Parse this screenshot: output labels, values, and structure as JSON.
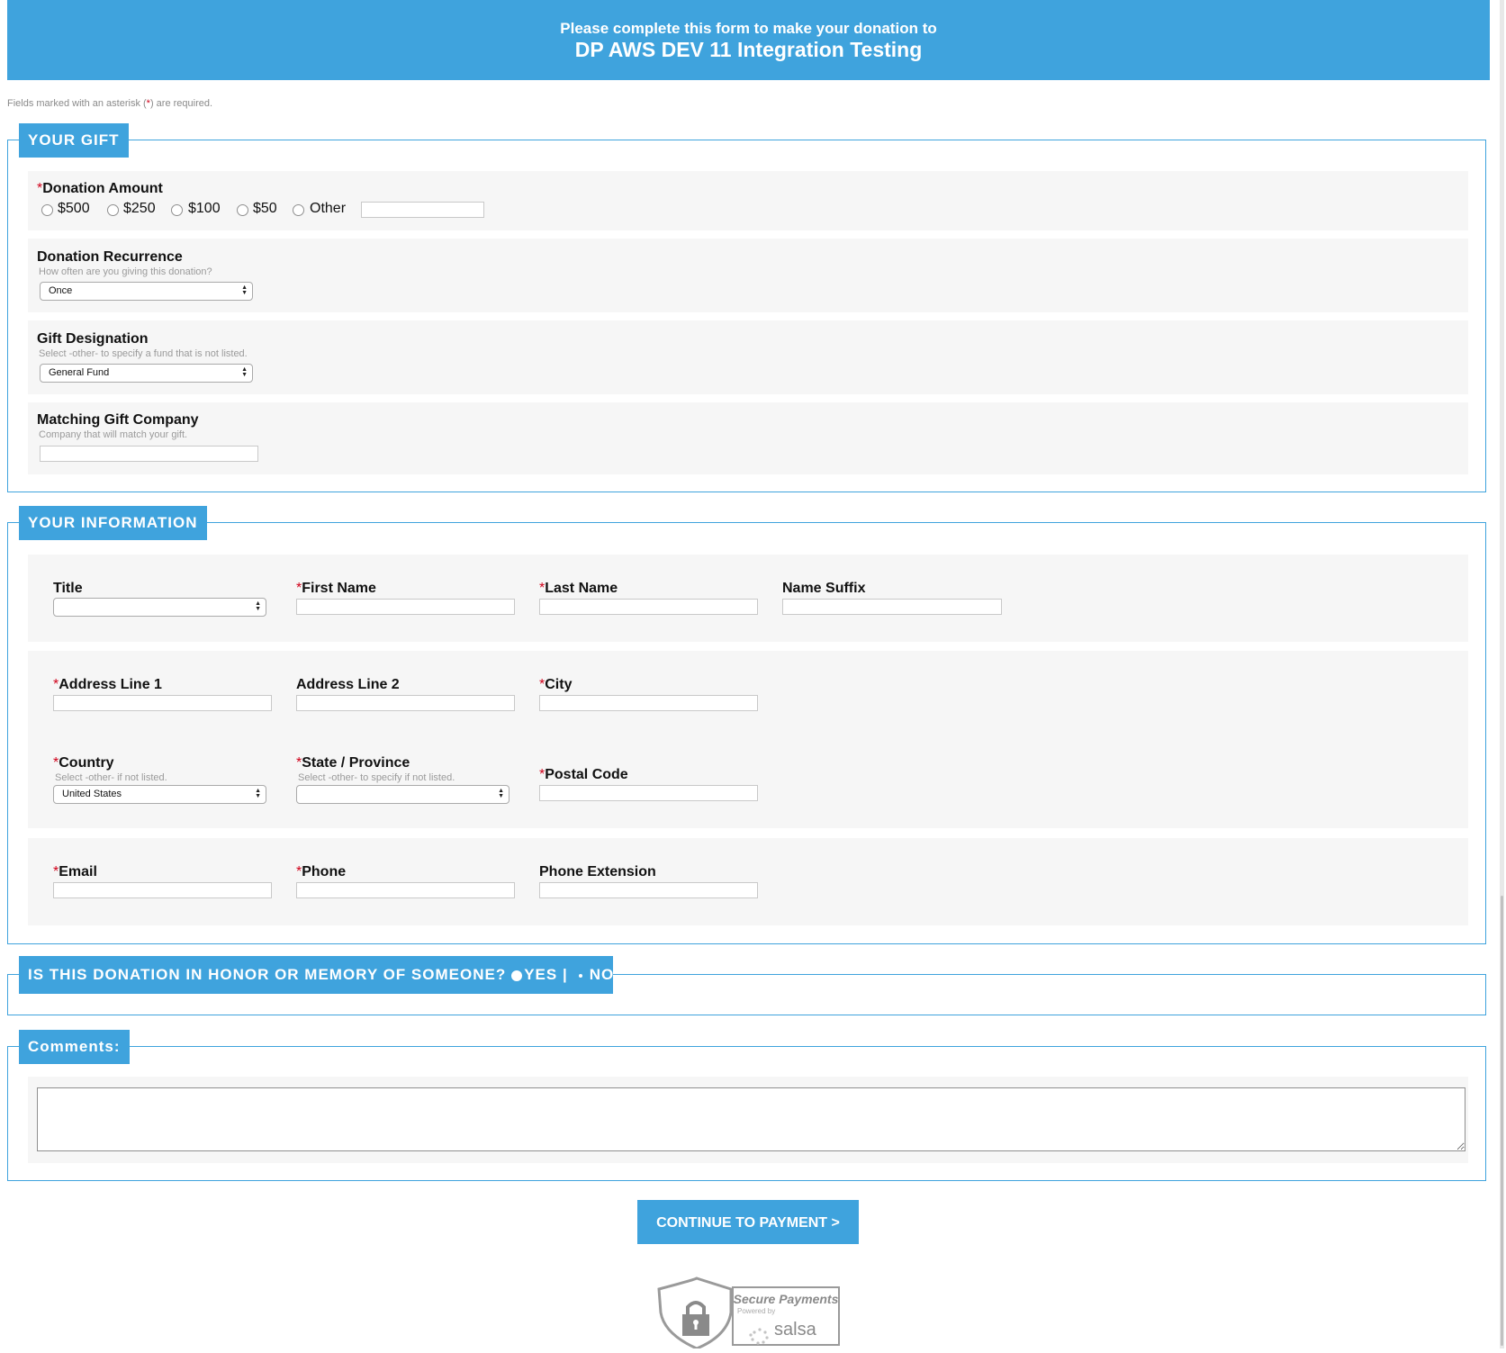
{
  "header": {
    "line1": "Please complete this form to make your donation to",
    "line2": "DP AWS DEV 11 Integration Testing"
  },
  "required_note": {
    "before": "Fields marked with an asterisk (",
    "asterisk": "*",
    "after": ") are required."
  },
  "your_gift": {
    "legend": "YOUR GIFT",
    "donation_amount": {
      "label": "Donation Amount",
      "options": [
        "$500",
        "$250",
        "$100",
        "$50",
        "Other"
      ],
      "other_value": ""
    },
    "recurrence": {
      "label": "Donation Recurrence",
      "hint": "How often are you giving this donation?",
      "selected": "Once"
    },
    "designation": {
      "label": "Gift Designation",
      "hint": "Select -other- to specify a fund that is not listed.",
      "selected": "General Fund"
    },
    "matching": {
      "label": "Matching Gift Company",
      "hint": "Company that will match your gift.",
      "value": ""
    }
  },
  "your_information": {
    "legend": "YOUR INFORMATION",
    "title": {
      "label": "Title",
      "selected": ""
    },
    "first_name": {
      "label": "First Name",
      "value": ""
    },
    "last_name": {
      "label": "Last Name",
      "value": ""
    },
    "name_suffix": {
      "label": "Name Suffix",
      "value": ""
    },
    "address1": {
      "label": "Address Line 1",
      "value": ""
    },
    "address2": {
      "label": "Address Line 2",
      "value": ""
    },
    "city": {
      "label": "City",
      "value": ""
    },
    "country": {
      "label": "Country",
      "hint": "Select -other- if not listed.",
      "selected": "United States"
    },
    "state": {
      "label": "State / Province",
      "hint": "Select -other- to specify if not listed.",
      "selected": ""
    },
    "postal": {
      "label": "Postal Code",
      "value": ""
    },
    "email": {
      "label": "Email",
      "value": ""
    },
    "phone": {
      "label": "Phone",
      "value": ""
    },
    "phone_ext": {
      "label": "Phone Extension",
      "value": ""
    }
  },
  "honor": {
    "question": "IS THIS DONATION IN HONOR OR MEMORY OF SOMEONE?",
    "yes": "YES",
    "separator": "|",
    "no": "NO"
  },
  "comments": {
    "legend": "Comments:",
    "value": ""
  },
  "continue_button": "CONTINUE TO PAYMENT >",
  "secure_badge": {
    "title": "Secure Payments",
    "powered": "Powered by",
    "brand": "salsa"
  },
  "colors": {
    "accent": "#3fa3dd",
    "required": "#d0021b",
    "panel": "#f6f6f6"
  }
}
